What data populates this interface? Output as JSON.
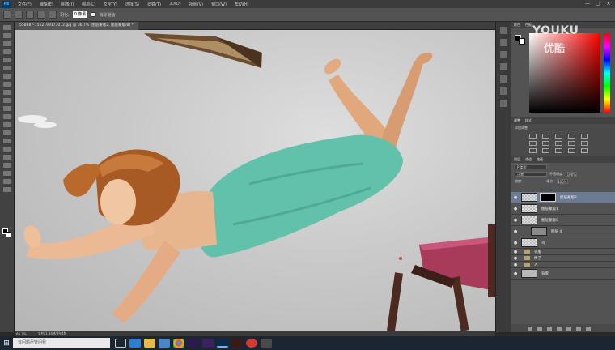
{
  "app": {
    "logo": "Ps"
  },
  "menu": [
    "文件(F)",
    "编辑(E)",
    "图像(I)",
    "图层(L)",
    "文字(Y)",
    "选择(S)",
    "滤镜(T)",
    "3D(D)",
    "视图(V)",
    "窗口(W)",
    "帮助(H)"
  ],
  "window_controls": [
    "—",
    "▢",
    "✕"
  ],
  "options": {
    "feather_label": "羽化:",
    "feather_value": "0 像素",
    "antialias_label": "消除锯齿"
  },
  "document": {
    "tab_title": "558687-1512199173012.jpg @ 66.7% (图层蒙版2, 图层蒙版/8) *",
    "zoom": "66.7%",
    "file_info": "文档:1.94M/39.4M"
  },
  "watermark": {
    "en": "YOUKU",
    "zh": "优酷"
  },
  "colors": {
    "fg": "#000000",
    "bg": "#ffffff"
  },
  "panels": {
    "color_tabs": [
      "颜色",
      "色板"
    ],
    "adjust_tabs": [
      "调整",
      "样式"
    ],
    "adjust_title": "添加调整",
    "layer_tabs": [
      "图层",
      "通道",
      "路径"
    ],
    "kind": "P 类型",
    "blend": "正常",
    "opacity_label": "不透明度:",
    "opacity": "100%",
    "lock_label": "锁定:",
    "fill_label": "填充:",
    "fill": "100%"
  },
  "layers": [
    {
      "name": "图层蒙版2",
      "selected": true,
      "mask": true,
      "type": "layer"
    },
    {
      "name": "图层蒙版1",
      "selected": false,
      "mask": false,
      "type": "layer"
    },
    {
      "name": "图层蒙版0",
      "selected": false,
      "mask": false,
      "type": "layer"
    },
    {
      "name": "图层 4",
      "selected": false,
      "mask": false,
      "type": "layer"
    },
    {
      "name": "鸟",
      "selected": false,
      "mask": false,
      "type": "layer"
    },
    {
      "name": "衣服",
      "selected": false,
      "mask": false,
      "type": "group"
    },
    {
      "name": "椅子",
      "selected": false,
      "mask": false,
      "type": "group"
    },
    {
      "name": "人",
      "selected": false,
      "mask": false,
      "type": "group"
    },
    {
      "name": "背景",
      "selected": false,
      "mask": false,
      "type": "background"
    }
  ],
  "taskbar": {
    "search_placeholder": "有问题尽管问我",
    "apps": [
      "task-view",
      "edge",
      "explorer",
      "store",
      "chrome",
      "premiere",
      "after-effects",
      "photoshop",
      "animate",
      "netease-music",
      "images"
    ]
  }
}
